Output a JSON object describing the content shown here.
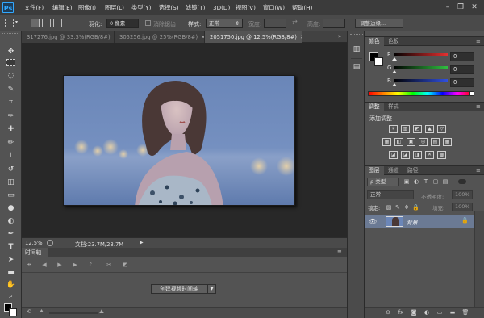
{
  "app": {
    "logo": "Ps"
  },
  "menu": [
    "文件(F)",
    "编辑(E)",
    "图像(I)",
    "图层(L)",
    "类型(Y)",
    "选择(S)",
    "滤镜(T)",
    "3D(D)",
    "视图(V)",
    "窗口(W)",
    "帮助(H)"
  ],
  "window_controls": {
    "minimize": "–",
    "restore": "❐",
    "close": "✕"
  },
  "options": {
    "feather_label": "羽化:",
    "feather_value": "0 像素",
    "antialias_label": "消除锯齿",
    "style_label": "样式:",
    "style_value": "正常",
    "width_label": "宽度:",
    "swap_icon": "⇄",
    "height_label": "高度:",
    "refine_edge": "调整边缘..."
  },
  "tabs": [
    {
      "label": "317276.jpg @ 33.3%(RGB/8#)",
      "close": "✕"
    },
    {
      "label": "305256.jpg @ 25%(RGB/8#)",
      "close": "✕"
    },
    {
      "label": "2051750.jpg @ 12.5%(RGB/8#)",
      "close": "✕"
    }
  ],
  "status": {
    "zoom": "12.5%",
    "doc": "文档:23.7M/23.7M",
    "arrow": "▶"
  },
  "timeline": {
    "tab": "时间轴",
    "create_button": "创建视频时间轴",
    "dropdown": "▼"
  },
  "color_panel": {
    "tabs": [
      "颜色",
      "色板"
    ],
    "sliders": [
      {
        "label": "R",
        "value": "0",
        "color": "#e53030"
      },
      {
        "label": "G",
        "value": "0",
        "color": "#30c040"
      },
      {
        "label": "B",
        "value": "0",
        "color": "#3050e0"
      }
    ]
  },
  "adjust_panel": {
    "tabs": [
      "调整",
      "样式"
    ],
    "title": "添加调整",
    "row1": [
      "☀",
      "▥",
      "◩",
      "▲",
      "▽"
    ],
    "row2": [
      "▦",
      "◧",
      "▣",
      "◎",
      "▤"
    ],
    "row3": [
      "◪",
      "◪",
      "◨",
      "✕",
      "▩"
    ]
  },
  "layers_panel": {
    "tabs": [
      "图层",
      "通道",
      "路径"
    ],
    "filter_label": "ρ 类型",
    "blend_mode": "正常",
    "opacity_label": "不透明度:",
    "opacity_value": "100%",
    "lock_label": "锁定:",
    "fill_label": "填充:",
    "fill_value": "100%",
    "layer_name": "背景",
    "bottom_icons": [
      "⊖",
      "fx",
      "◙",
      "◐",
      "▭",
      "▬",
      "🗑"
    ]
  },
  "accent_colors": {
    "ps_blue": "#31a8ff",
    "layer_selected": "#6b7a94"
  }
}
